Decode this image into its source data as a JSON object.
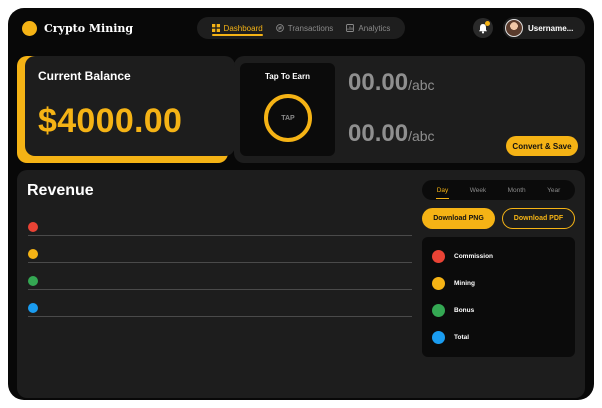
{
  "app": {
    "name": "Crypto Mining",
    "accent": "#f5b315"
  },
  "nav": {
    "items": [
      {
        "label": "Dashboard",
        "icon": "grid-icon",
        "active": true
      },
      {
        "label": "Transactions",
        "icon": "exchange-icon",
        "active": false
      },
      {
        "label": "Analytics",
        "icon": "chart-icon",
        "active": false
      }
    ]
  },
  "user": {
    "name": "Username...",
    "notification_icon": "bell-icon"
  },
  "balance": {
    "title": "Current Balance",
    "value": "$4000.00"
  },
  "earn": {
    "title": "Tap To Earn",
    "tap_label": "TAP",
    "amount_1": "00.00",
    "unit_1": "/abc",
    "amount_2": "00.00",
    "unit_2": "/abc",
    "convert_label": "Convert & Save"
  },
  "revenue": {
    "title": "Revenue",
    "periods": [
      {
        "label": "Day",
        "active": true
      },
      {
        "label": "Week",
        "active": false
      },
      {
        "label": "Month",
        "active": false
      },
      {
        "label": "Year",
        "active": false
      }
    ],
    "download_png": "Download PNG",
    "download_pdf": "Download PDF",
    "legend": [
      {
        "label": "Commission",
        "color": "#ea4335"
      },
      {
        "label": "Mining",
        "color": "#f5b315"
      },
      {
        "label": "Bonus",
        "color": "#34a853"
      },
      {
        "label": "Total",
        "color": "#1a9cf0"
      }
    ]
  }
}
